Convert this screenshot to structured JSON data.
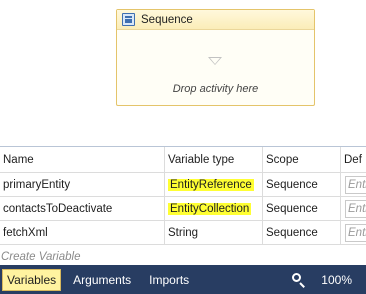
{
  "designer": {
    "sequence": {
      "title": "Sequence",
      "icon": "sequence-icon",
      "placeholder": "Drop activity here"
    }
  },
  "variables": {
    "headers": {
      "name": "Name",
      "type": "Variable type",
      "scope": "Scope",
      "default": "Def"
    },
    "rows": [
      {
        "name": "primaryEntity",
        "type": "EntityReference",
        "type_highlighted": true,
        "scope": "Sequence",
        "default": "Entit"
      },
      {
        "name": "contactsToDeactivate",
        "type": "EntityCollection",
        "type_highlighted": true,
        "scope": "Sequence",
        "default": "Entit"
      },
      {
        "name": "fetchXml",
        "type": "String",
        "type_highlighted": false,
        "scope": "Sequence",
        "default": "Entit"
      }
    ],
    "create_label": "Create Variable"
  },
  "bottom_bar": {
    "tabs": [
      {
        "label": "Variables",
        "active": true
      },
      {
        "label": "Arguments",
        "active": false
      },
      {
        "label": "Imports",
        "active": false
      }
    ],
    "zoom_icon": "zoom-icon",
    "zoom_level": "100%"
  },
  "colors": {
    "bottom_bar": "#283d62",
    "highlight": "#ffff33",
    "sequence_border": "#e4c46a"
  }
}
